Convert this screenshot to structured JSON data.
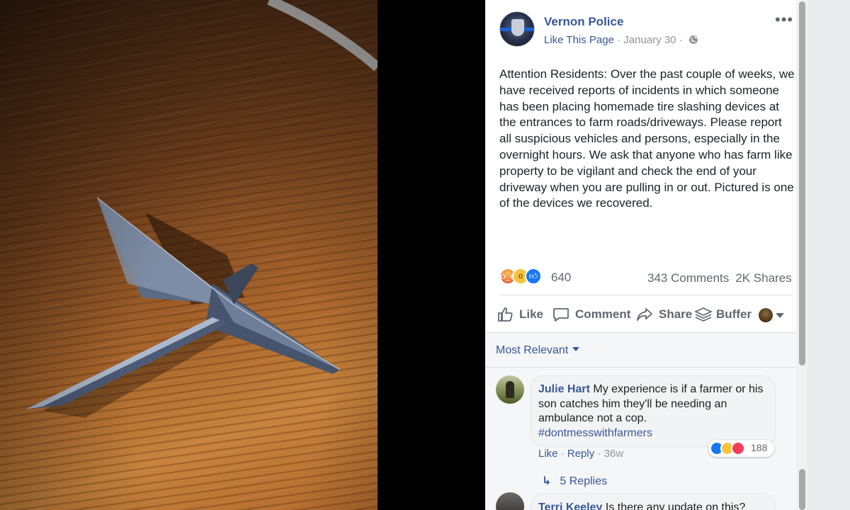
{
  "page": {
    "name": "Vernon Police",
    "like_page": "Like This Page",
    "separator1": " · ",
    "date": "January 30",
    "separator2": " · ",
    "more_menu": "•••"
  },
  "post": {
    "text": "Attention Residents: Over the past couple of weeks, we have received reports of incidents in which someone has been placing homemade tire slashing devices at the entrances to farm roads/driveways. Please report all suspicious vehicles and persons, especially in the overnight hours. We ask that anyone who has farm like property to be vigilant and check the end of your driveway when you are pulling in or out. Pictured is one of the devices we recovered."
  },
  "reactions": {
    "icons": [
      "angry-reaction",
      "wow-reaction",
      "like-reaction"
    ],
    "count": "640",
    "comments": "343 Comments",
    "shares": "2K Shares"
  },
  "actions": {
    "like": "Like",
    "comment": "Comment",
    "share": "Share",
    "buffer": "Buffer"
  },
  "comments_section": {
    "sort_label": "Most Relevant",
    "comments": [
      {
        "author": "Julie Hart",
        "text": "My experience is if a farmer or his son catches him they'll be needing an ambulance not a cop.",
        "hashtag": "#dontmesswithfarmers",
        "reaction_count": "188",
        "like": "Like",
        "reply": "Reply",
        "sep": " · ",
        "time": "36w",
        "replies": "5 Replies"
      },
      {
        "author": "Terri Keeley",
        "text": "Is there any update on this?"
      }
    ]
  },
  "colors": {
    "link_blue": "#365899",
    "meta_gray": "#90949c",
    "like_blue": "#1877f2",
    "panel_bg": "#ffffff",
    "backdrop": "#e9ebee"
  }
}
